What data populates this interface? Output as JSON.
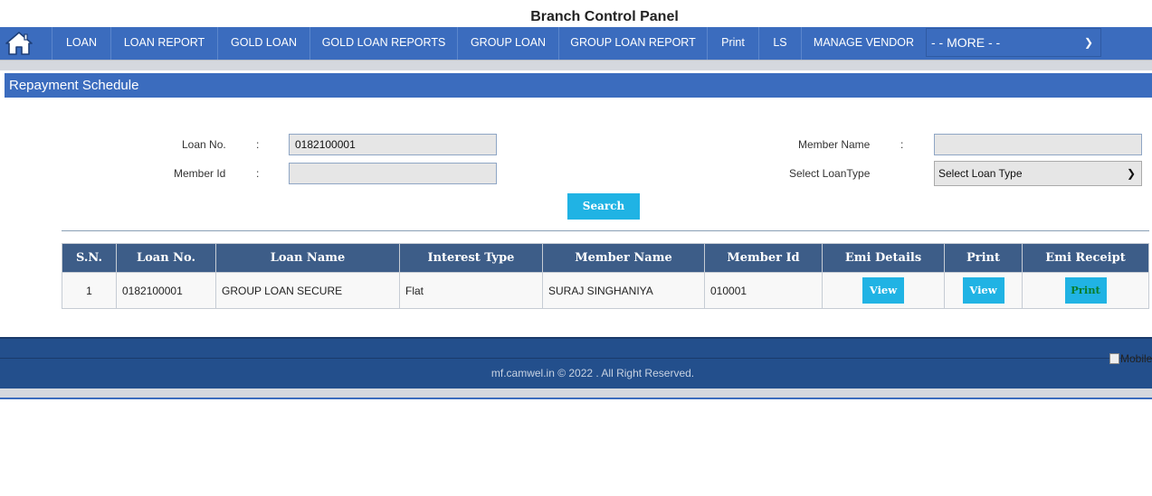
{
  "header": {
    "title": "Branch Control Panel"
  },
  "nav": {
    "items": [
      "LOAN",
      "LOAN REPORT",
      "GOLD LOAN",
      "GOLD LOAN REPORTS",
      "GROUP LOAN",
      "GROUP LOAN REPORT",
      "Print",
      "LS",
      "MANAGE VENDOR"
    ],
    "more": "- - MORE - -"
  },
  "section": {
    "title": "Repayment Schedule"
  },
  "form": {
    "loan_no_label": "Loan No.",
    "loan_no_value": "0182100001",
    "member_id_label": "Member Id",
    "member_id_value": "",
    "member_name_label": "Member Name",
    "member_name_value": "",
    "loan_type_label": "Select LoanType",
    "loan_type_value": "Select Loan Type",
    "colon": ":",
    "search_label": "Search"
  },
  "table": {
    "headers": [
      "S.N.",
      "Loan No.",
      "Loan Name",
      "Interest Type",
      "Member Name",
      "Member Id",
      "Emi Details",
      "Print",
      "Emi Receipt"
    ],
    "rows": [
      {
        "sn": "1",
        "loan_no": "0182100001",
        "loan_name": "GROUP LOAN SECURE",
        "interest_type": "Flat",
        "member_name": "SURAJ SINGHANIYA",
        "member_id": "010001",
        "emi_details": "View",
        "print": "View",
        "emi_receipt": "Print"
      }
    ]
  },
  "footer": {
    "copyright": "mf.camwel.in © 2022 . All Right Reserved.",
    "mobile_alt": "Mobile"
  },
  "colors": {
    "nav": "#3b6cbe",
    "table_header": "#3d5d88",
    "button": "#20b3e4",
    "footer": "#234f8c"
  }
}
